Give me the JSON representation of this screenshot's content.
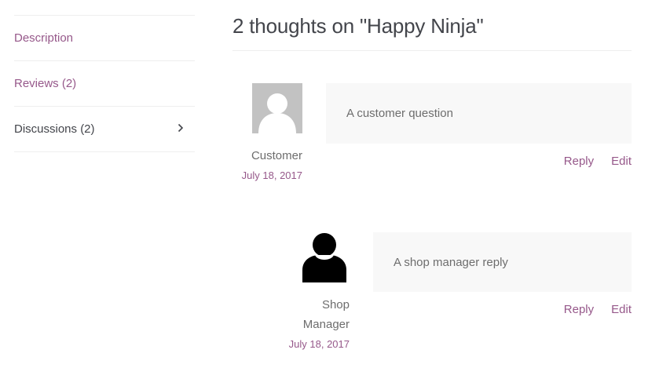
{
  "tabs": [
    {
      "label": "Description"
    },
    {
      "label": "Reviews (2)"
    },
    {
      "label": "Discussions (2)"
    }
  ],
  "comments": {
    "title": "2 thoughts on \"Happy Ninja\"",
    "items": [
      {
        "author": "Customer",
        "date": "July 18, 2017",
        "text": "A customer question",
        "reply_label": "Reply",
        "edit_label": "Edit",
        "avatar": "default-user-avatar"
      },
      {
        "author_line1": "Shop",
        "author_line2": "Manager",
        "date": "July 18, 2017",
        "text": "A shop manager reply",
        "reply_label": "Reply",
        "edit_label": "Edit",
        "avatar": "user-silhouette-avatar"
      }
    ]
  },
  "colors": {
    "link": "#96588a",
    "text": "#43454b",
    "muted": "#6d6d6d",
    "bubble_bg": "#f8f8f8",
    "border": "#eeeeee"
  }
}
